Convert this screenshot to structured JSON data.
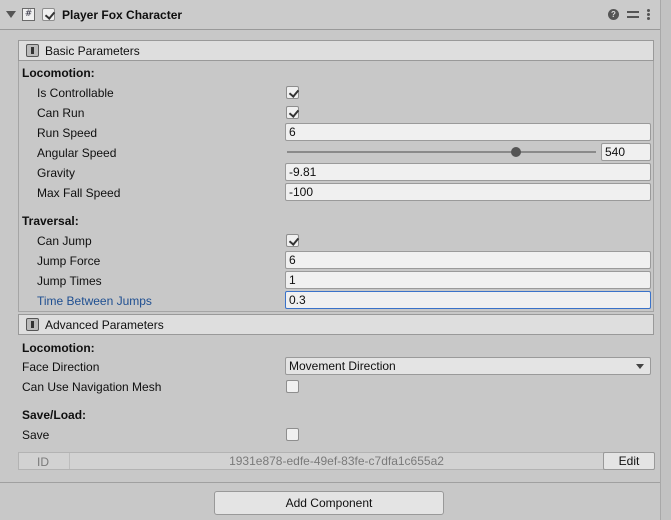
{
  "component": {
    "title": "Player Fox Character",
    "enabled": true
  },
  "basic": {
    "header": "Basic Parameters",
    "locomotion_title": "Locomotion:",
    "is_controllable_label": "Is Controllable",
    "is_controllable": true,
    "can_run_label": "Can Run",
    "can_run": true,
    "run_speed_label": "Run Speed",
    "run_speed": "6",
    "angular_speed_label": "Angular Speed",
    "angular_speed": "540",
    "angular_speed_slider_fraction": 0.74,
    "gravity_label": "Gravity",
    "gravity": "-9.81",
    "max_fall_speed_label": "Max Fall Speed",
    "max_fall_speed": "-100",
    "traversal_title": "Traversal:",
    "can_jump_label": "Can Jump",
    "can_jump": true,
    "jump_force_label": "Jump Force",
    "jump_force": "6",
    "jump_times_label": "Jump Times",
    "jump_times": "1",
    "time_between_jumps_label": "Time Between Jumps",
    "time_between_jumps": "0.3"
  },
  "advanced": {
    "header": "Advanced Parameters",
    "locomotion_title": "Locomotion:",
    "face_direction_label": "Face Direction",
    "face_direction": "Movement Direction",
    "can_use_navmesh_label": "Can Use Navigation Mesh",
    "can_use_navmesh": false,
    "saveload_title": "Save/Load:",
    "save_label": "Save",
    "save": false
  },
  "id_bar": {
    "label": "ID",
    "value": "1931e878-edfe-49ef-83fe-c7dfa1c655a2",
    "edit_label": "Edit"
  },
  "add_component_label": "Add Component",
  "icons": {
    "foldout": "foldout-arrow-icon",
    "script": "script-icon",
    "help": "help-icon",
    "presets": "presets-icon",
    "menu": "kebab-menu-icon",
    "basic_section": "section-icon",
    "advanced_section": "section-icon"
  }
}
